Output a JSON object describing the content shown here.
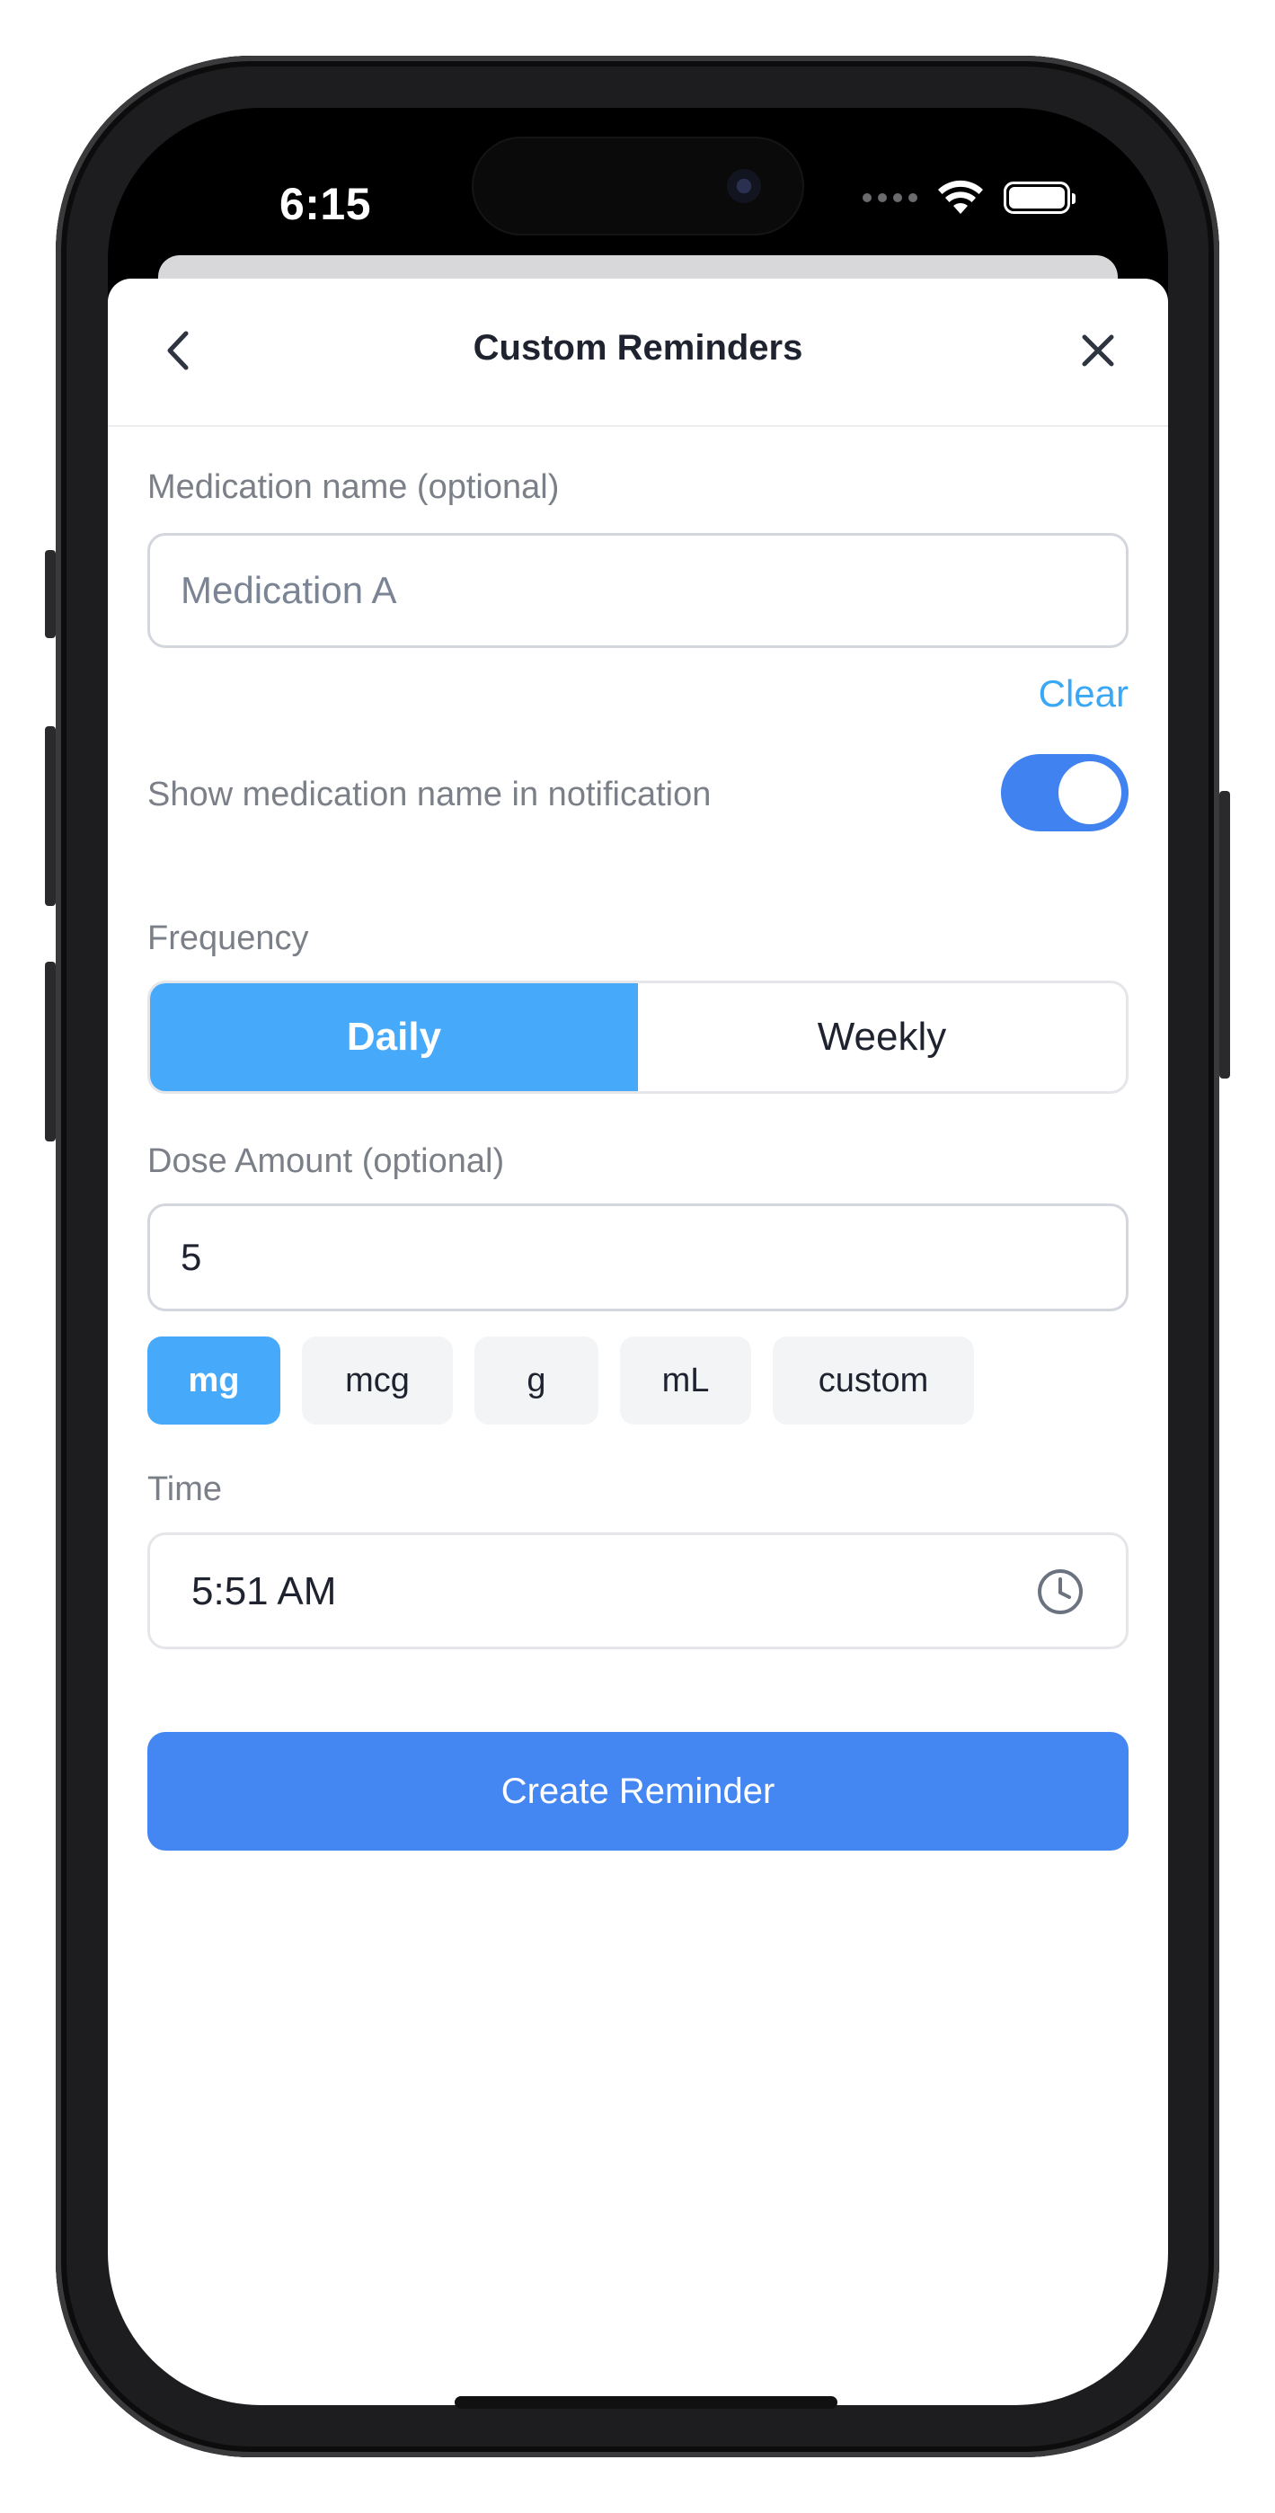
{
  "status_bar": {
    "time": "6:15"
  },
  "header": {
    "title": "Custom Reminders"
  },
  "medication": {
    "label": "Medication name (optional)",
    "placeholder": "Medication A",
    "value": "",
    "clear_label": "Clear"
  },
  "notification_toggle": {
    "label": "Show medication name in notification",
    "enabled": true
  },
  "frequency": {
    "label": "Frequency",
    "options": [
      "Daily",
      "Weekly"
    ],
    "selected": "Daily"
  },
  "dose": {
    "label": "Dose Amount (optional)",
    "value": "5",
    "units": [
      "mg",
      "mcg",
      "g",
      "mL",
      "custom"
    ],
    "selected_unit": "mg"
  },
  "time": {
    "label": "Time",
    "value": "5:51 AM"
  },
  "actions": {
    "create_label": "Create Reminder"
  },
  "colors": {
    "accent_blue": "#46a9fa",
    "primary_button": "#4486f2",
    "toggle_on": "#3f82f0",
    "link": "#3aa8f4"
  }
}
